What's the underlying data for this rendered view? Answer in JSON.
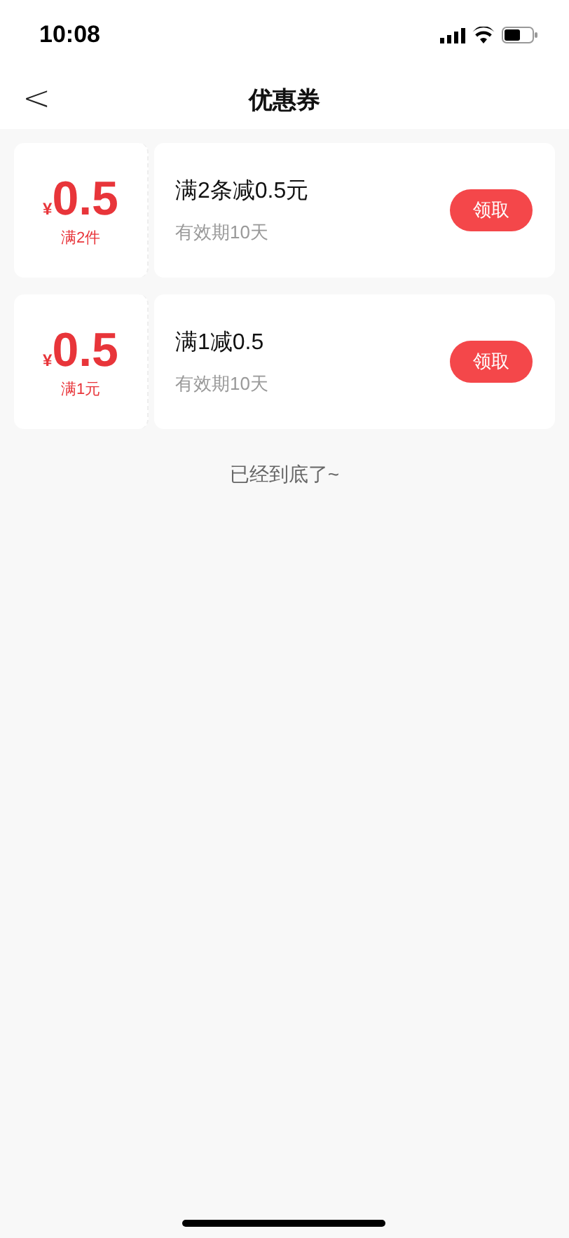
{
  "status_bar": {
    "time": "10:08"
  },
  "nav": {
    "back": "<",
    "title": "优惠券"
  },
  "coupons": [
    {
      "currency": "¥",
      "amount": "0.5",
      "condition": "满2件",
      "title": "满2条减0.5元",
      "validity": "有效期10天",
      "action": "领取"
    },
    {
      "currency": "¥",
      "amount": "0.5",
      "condition": "满1元",
      "title": "满1减0.5",
      "validity": "有效期10天",
      "action": "领取"
    }
  ],
  "footer": "已经到底了~"
}
